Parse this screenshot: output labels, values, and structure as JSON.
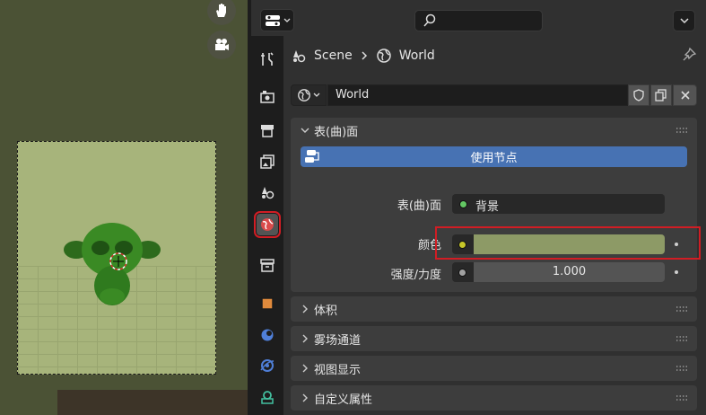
{
  "breadcrumb": {
    "scene": "Scene",
    "world": "World"
  },
  "world_selector": {
    "name": "World"
  },
  "surface_panel": {
    "title": "表(曲)面",
    "use_nodes_label": "使用节点",
    "surface_label": "表(曲)面",
    "surface_value": "背景",
    "color_label": "颜色",
    "color_value": "#8d9a66",
    "strength_label": "强度/力度",
    "strength_value": "1.000"
  },
  "collapsed_panels": [
    "体积",
    "雾场通道",
    "视图显示",
    "自定义属性"
  ],
  "colors": {
    "accent": "#4772b3",
    "highlight": "#d11d24",
    "world_green": "#8d9a66"
  },
  "icons": [
    "editor-type-icon",
    "search-icon",
    "hand-icon",
    "camera-icon",
    "tool-icon",
    "render-icon",
    "output-icon",
    "view-layer-icon",
    "scene-icon",
    "world-icon",
    "collection-icon",
    "object-icon",
    "modifier-icon",
    "particles-icon",
    "physics-icon",
    "pin-icon",
    "fake-user-icon",
    "duplicate-icon",
    "close-icon"
  ]
}
